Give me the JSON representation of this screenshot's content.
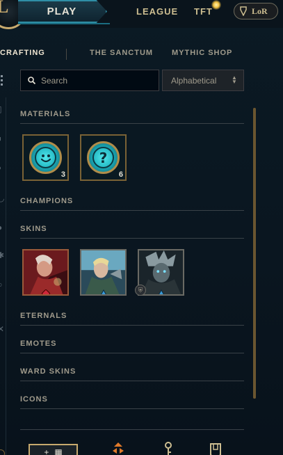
{
  "topbar": {
    "logo_letter": "L",
    "play_label": "PLAY",
    "nav": [
      "LEAGUE",
      "TFT"
    ],
    "lor_label": "LoR"
  },
  "subnav": {
    "tabs": [
      {
        "label": "CRAFTING",
        "active": true
      },
      {
        "label": "THE SANCTUM",
        "active": false
      },
      {
        "label": "MYTHIC SHOP",
        "active": false
      }
    ]
  },
  "search": {
    "placeholder": "Search",
    "value": ""
  },
  "sort": {
    "selected": "Alphabetical"
  },
  "sections": {
    "materials": "MATERIALS",
    "champions": "CHAMPIONS",
    "skins": "SKINS",
    "eternals": "ETERNALS",
    "emotes": "EMOTES",
    "ward_skins": "WARD SKINS",
    "icons": "ICONS"
  },
  "materials": [
    {
      "icon": "smiley-emote-orb-icon",
      "count": "3"
    },
    {
      "icon": "mystery-orb-icon",
      "count": "6"
    }
  ],
  "skins": [
    {
      "icon": "red-skin-shard",
      "gem": "red-gem"
    },
    {
      "icon": "blue-skin-shard",
      "gem": "blue-gem"
    },
    {
      "icon": "dark-skin-shard",
      "gem": "blue-gem"
    }
  ],
  "colors": {
    "gold": "#c8aa6e",
    "teal": "#2f8fa6",
    "text": "#a09b8c",
    "bg": "#0a1620"
  }
}
